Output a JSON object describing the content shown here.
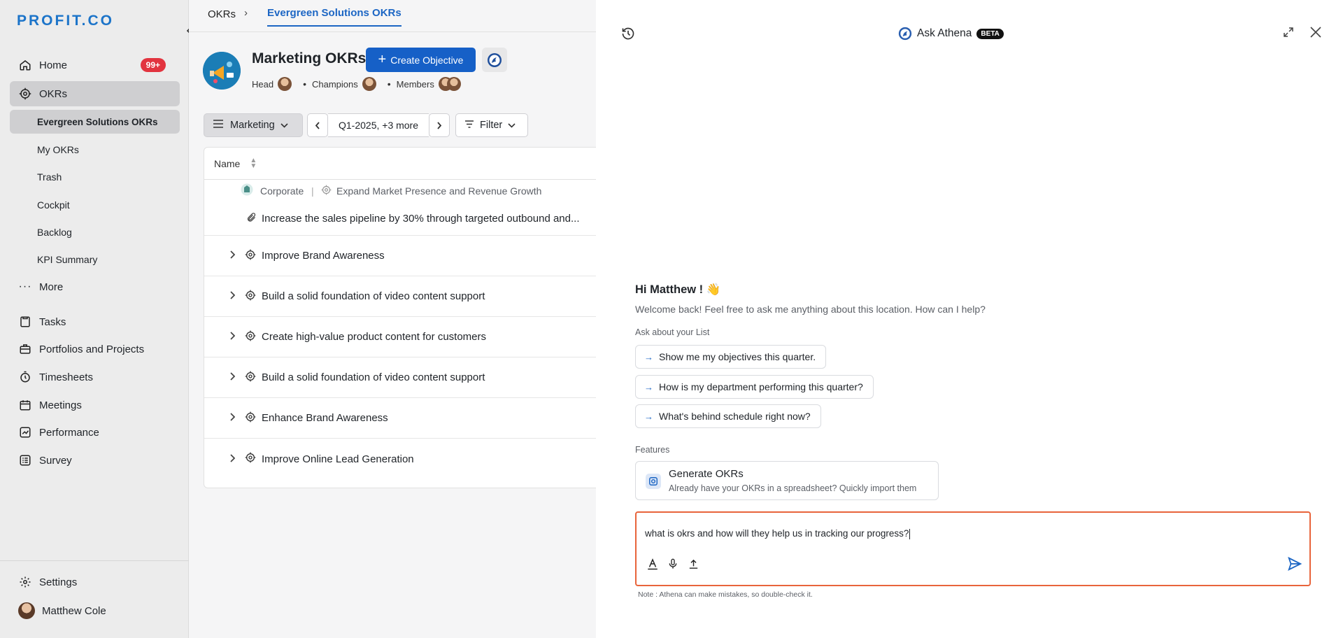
{
  "sidebar": {
    "logo": "PROFIT.CO",
    "collapse_icon": "chevron-left-icon",
    "home": {
      "label": "Home",
      "badge": "99+"
    },
    "okrs": {
      "label": "OKRs"
    },
    "sub_items": [
      "Evergreen Solutions OKRs",
      "My OKRs",
      "Trash",
      "Cockpit",
      "Backlog",
      "KPI Summary"
    ],
    "more": "More",
    "items": [
      "Tasks",
      "Portfolios and Projects",
      "Timesheets",
      "Meetings",
      "Performance",
      "Survey"
    ],
    "settings": "Settings",
    "user": "Matthew Cole"
  },
  "main": {
    "breadcrumb": {
      "root": "OKRs",
      "separator": "›",
      "current": "Evergreen Solutions OKRs"
    },
    "title": "Marketing OKRs",
    "create_button": "Create Objective",
    "people": {
      "head": "Head",
      "champions": "Champions",
      "members": "Members"
    },
    "filters": {
      "department": "Marketing",
      "period": "Q1-2025, +3 more",
      "filter": "Filter"
    },
    "table": {
      "header": "Name",
      "parent": {
        "corporate": "Corporate",
        "objective": "Expand Market Presence and Revenue Growth"
      },
      "key_result": "Increase the sales pipeline by 30% through targeted outbound and...",
      "rows": [
        "Improve Brand Awareness",
        "Build a solid foundation of video content support",
        "Create high-value product content for customers",
        "Build a solid foundation of video content support",
        "Enhance Brand Awareness",
        "Improve Online Lead Generation"
      ]
    }
  },
  "athena": {
    "title": "Ask Athena",
    "beta": "BETA",
    "greeting": "Hi Matthew ! 👋",
    "welcome": "Welcome back! Feel free to ask me anything about this location. How can I help?",
    "ask_label": "Ask about your List",
    "suggestions": [
      "Show me my objectives this quarter.",
      "How is my department performing this quarter?",
      "What's behind schedule right now?"
    ],
    "features_label": "Features",
    "feature": {
      "title": "Generate OKRs",
      "description": "Already have your OKRs in a spreadsheet? Quickly import them"
    },
    "input_value": "what is okrs and how will they help us in tracking our progress?",
    "note": "Note : Athena can make mistakes, so double-check it."
  },
  "colors": {
    "accent": "#1660c7",
    "badge": "#e2343f",
    "input_border": "#e8643b"
  }
}
